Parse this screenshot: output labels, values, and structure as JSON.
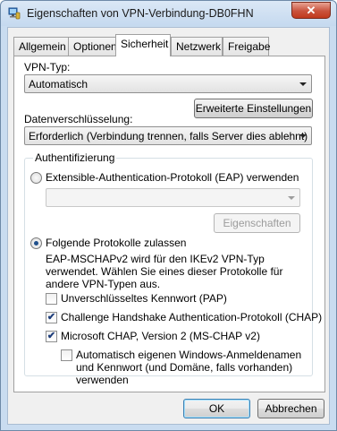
{
  "window": {
    "title": "Eigenschaften von VPN-Verbindung-DB0FHN",
    "close_glyph": "✕"
  },
  "tabs": [
    {
      "label": "Allgemein",
      "active": false
    },
    {
      "label": "Optionen",
      "active": false
    },
    {
      "label": "Sicherheit",
      "active": true
    },
    {
      "label": "Netzwerk",
      "active": false
    },
    {
      "label": "Freigabe",
      "active": false
    }
  ],
  "security": {
    "vpn_type_label": "VPN-Typ:",
    "vpn_type_value": "Automatisch",
    "advanced_button": "Erweiterte Einstellungen",
    "encryption_label": "Datenverschlüsselung:",
    "encryption_value": "Erforderlich (Verbindung trennen, falls Server dies ablehnt)",
    "auth": {
      "group_title": "Authentifizierung",
      "eap_label": "Extensible-Authentication-Protokoll (EAP) verwenden",
      "eap_selected": false,
      "eap_combo_value": "",
      "properties_button": "Eigenschaften",
      "protocols_label": "Folgende Protokolle zulassen",
      "protocols_selected": true,
      "info_text": "EAP-MSCHAPv2 wird für den IKEv2 VPN-Typ verwendet. Wählen Sie eines dieser Protokolle für andere VPN-Typen aus.",
      "pap_label": "Unverschlüsseltes Kennwort (PAP)",
      "pap_checked": false,
      "chap_label": "Challenge Handshake Authentication-Protokoll (CHAP)",
      "chap_checked": true,
      "mschap_label": "Microsoft CHAP, Version 2 (MS-CHAP v2)",
      "mschap_checked": true,
      "auto_logon_label": "Automatisch eigenen Windows-Anmeldenamen und Kennwort (und Domäne, falls vorhanden) verwenden",
      "auto_logon_checked": false
    }
  },
  "footer": {
    "ok_button": "OK",
    "cancel_button": "Abbrechen"
  },
  "colors": {
    "title_bar": "#c9dcf0",
    "close_button": "#c9533d",
    "radio_dot": "#1f4f8b"
  }
}
